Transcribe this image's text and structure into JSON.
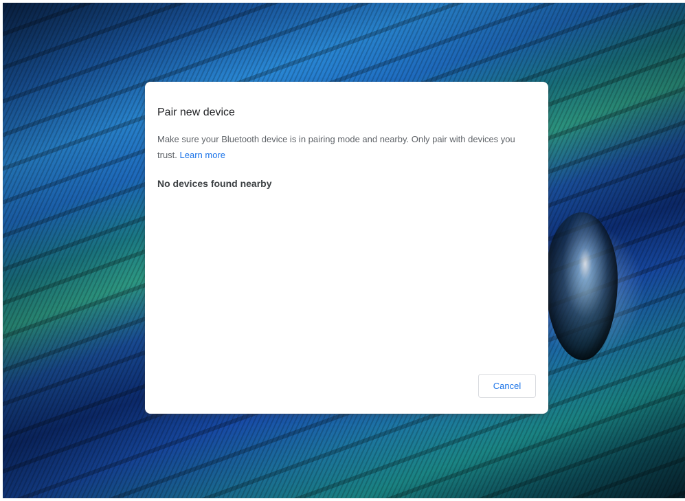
{
  "dialog": {
    "title": "Pair new device",
    "description": "Make sure your Bluetooth device is in pairing mode and nearby. Only pair with devices you trust.",
    "learn_more_label": "Learn more",
    "status": "No devices found nearby",
    "cancel_label": "Cancel"
  },
  "colors": {
    "accent": "#1a73e8",
    "title_text": "#202124",
    "body_text": "#5f6368",
    "dialog_background": "#ffffff"
  }
}
